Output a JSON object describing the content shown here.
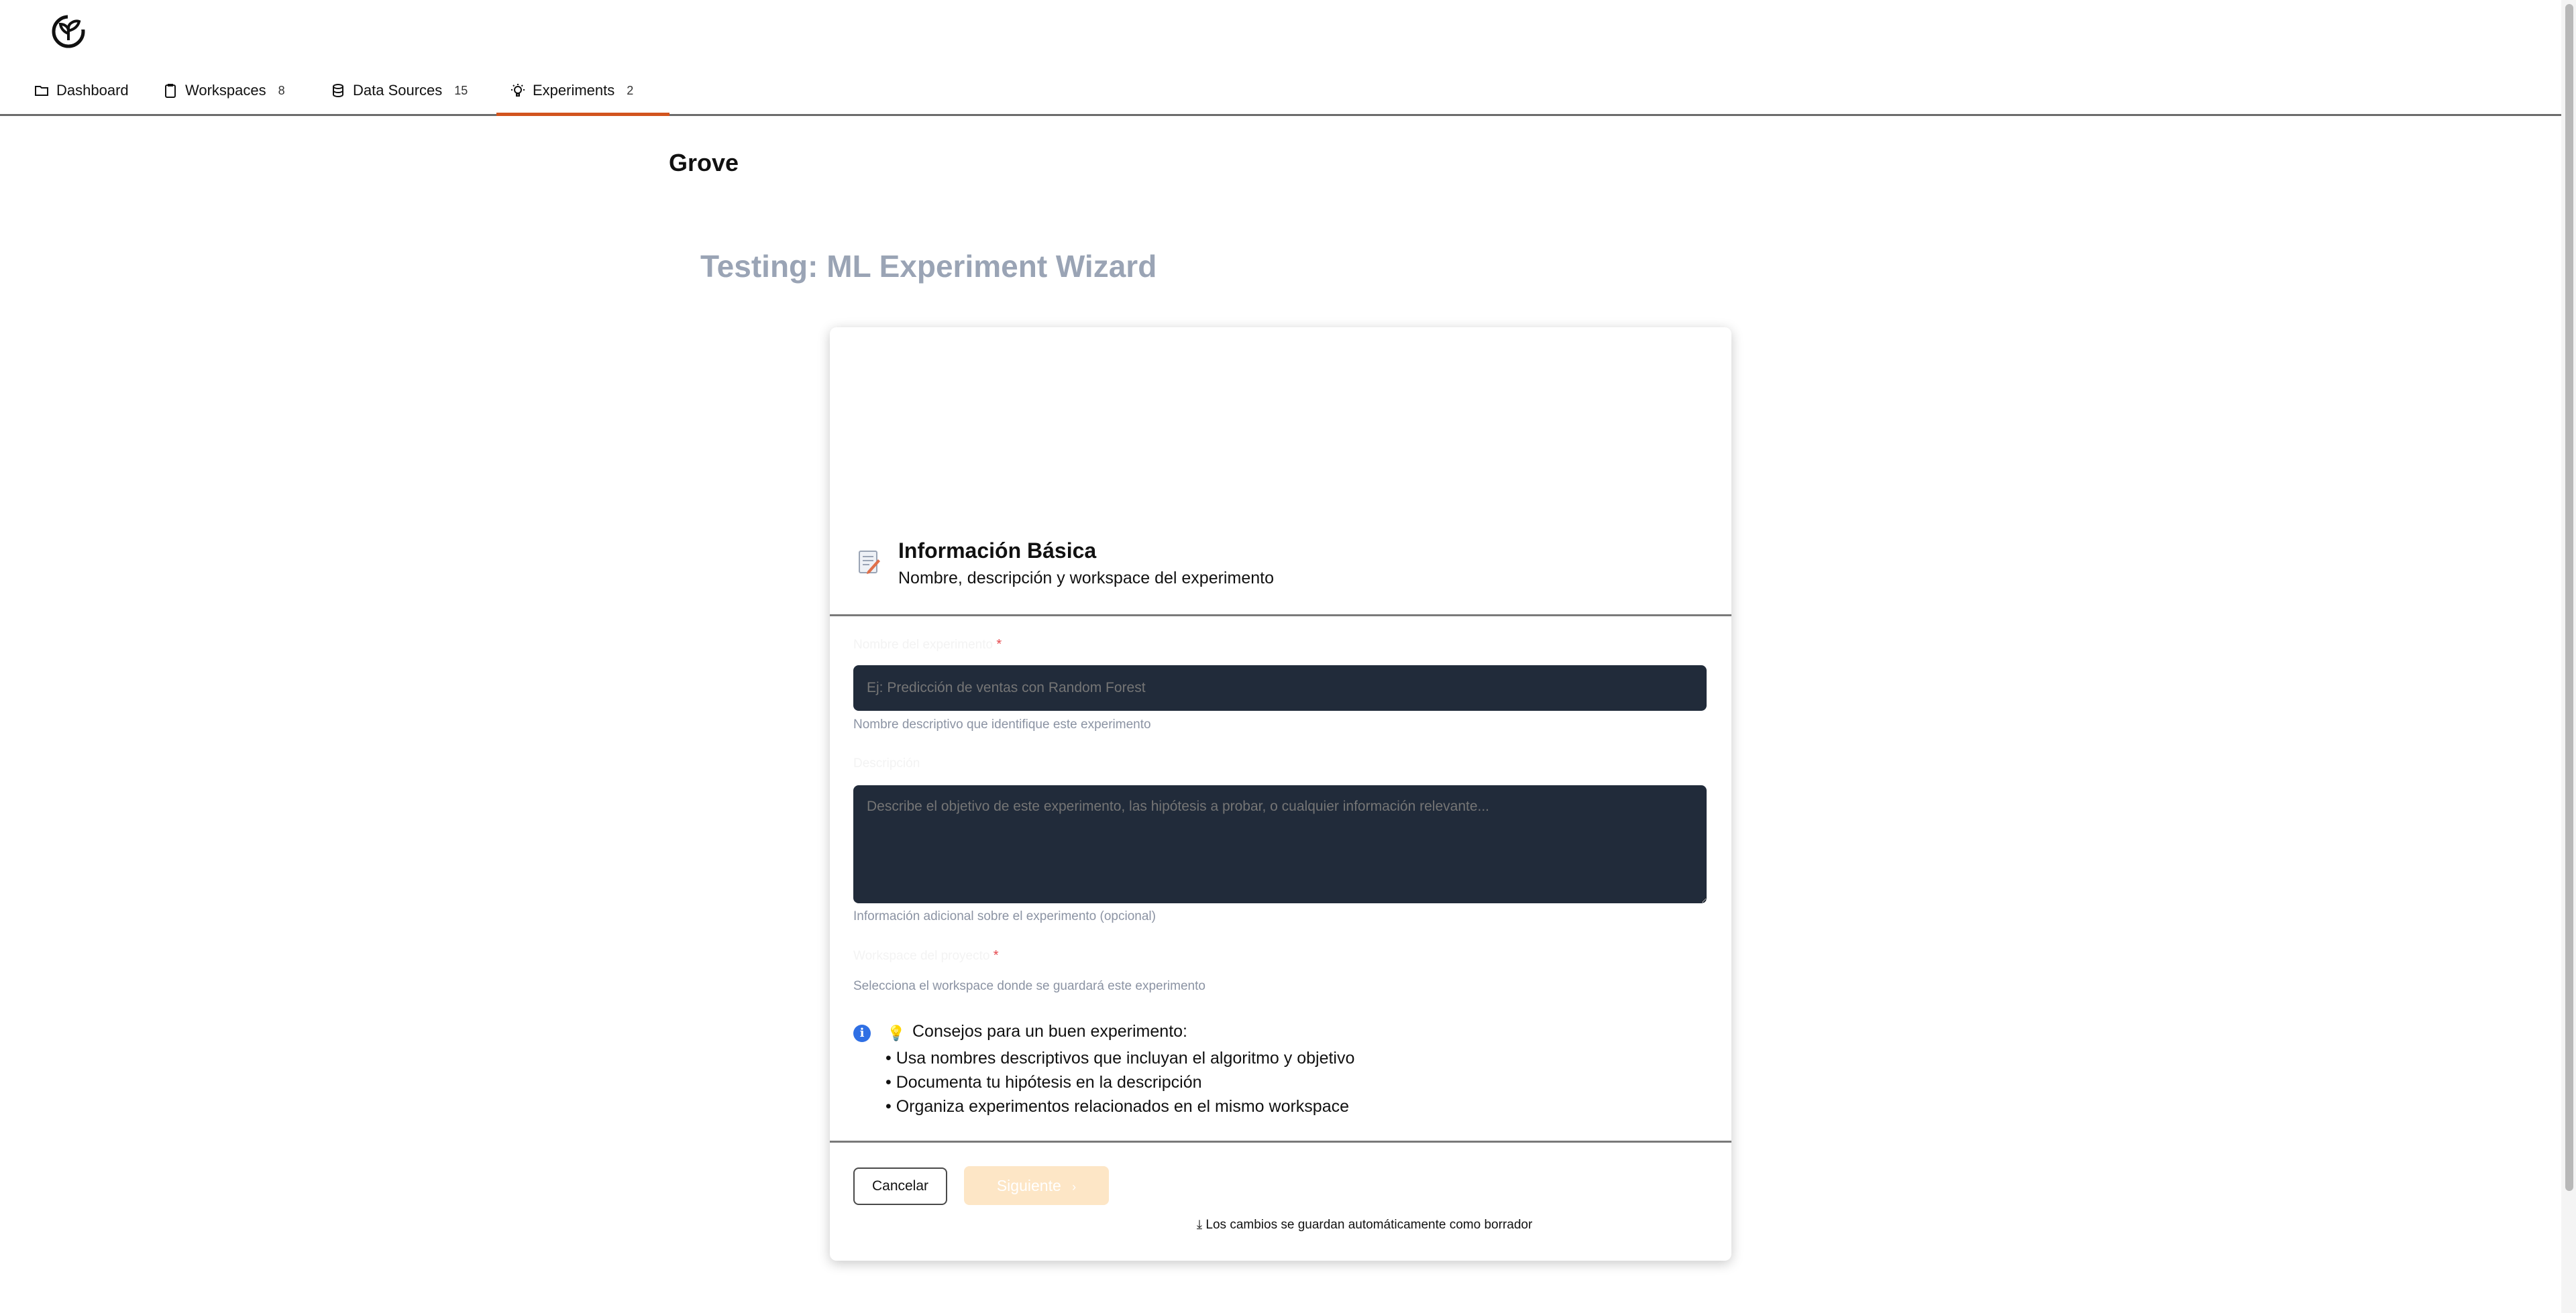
{
  "nav": {
    "items": [
      {
        "label": "Dashboard",
        "count": "",
        "icon": "folder-icon"
      },
      {
        "label": "Workspaces",
        "count": "8",
        "icon": "clipboard-icon"
      },
      {
        "label": "Data Sources",
        "count": "15",
        "icon": "database-icon"
      },
      {
        "label": "Experiments",
        "count": "2",
        "icon": "lightbulb-icon",
        "active": true
      }
    ]
  },
  "page": {
    "brand": "Grove",
    "wizard_title": "Testing: ML Experiment Wizard"
  },
  "step": {
    "title": "Información Básica",
    "subtitle": "Nombre, descripción y workspace del experimento"
  },
  "form": {
    "name": {
      "label": "Nombre del experimento",
      "placeholder": "Ej: Predicción de ventas con Random Forest",
      "help": "Nombre descriptivo que identifique este experimento"
    },
    "description": {
      "label": "Descripción",
      "placeholder": "Describe el objetivo de este experimento, las hipótesis a probar, o cualquier información relevante...",
      "help": "Información adicional sobre el experimento (opcional)"
    },
    "workspace": {
      "label": "Workspace del proyecto",
      "help": "Selecciona el workspace donde se guardará este experimento"
    },
    "required_mark": "*"
  },
  "tips": {
    "heading": "Consejos para un buen experimento:",
    "items": [
      "Usa nombres descriptivos que incluyan el algoritmo y objetivo",
      "Documenta tu hipótesis en la descripción",
      "Organiza experimentos relacionados en el mismo workspace"
    ]
  },
  "footer": {
    "cancel_label": "Cancelar",
    "next_label": "Siguiente",
    "autosave_text": "Los cambios se guardan automáticamente como borrador"
  },
  "colors": {
    "accent": "#d2541e",
    "field_bg": "#212b3a",
    "next_disabled": "#fde6c6"
  }
}
